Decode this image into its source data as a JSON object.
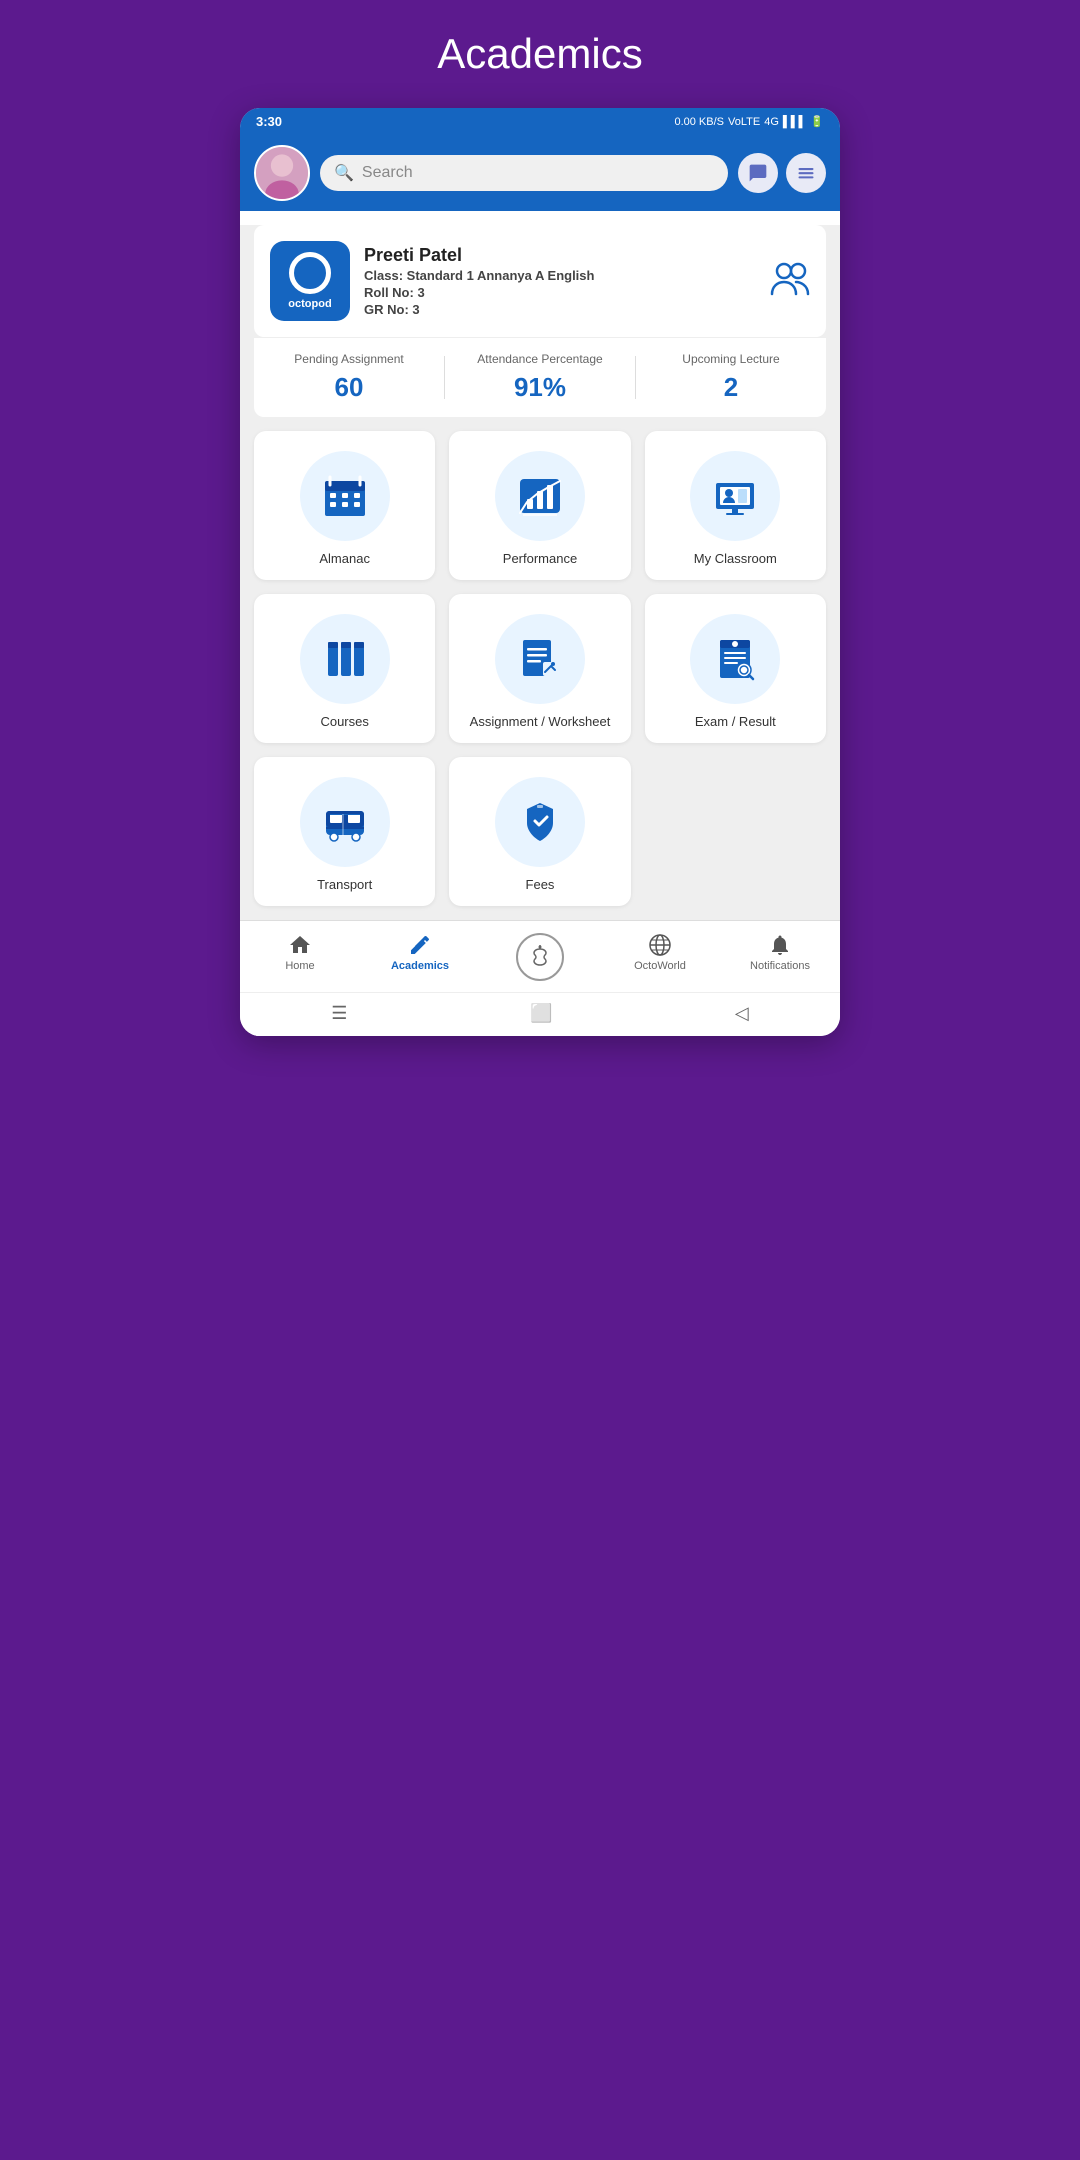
{
  "page": {
    "title": "Academics"
  },
  "statusBar": {
    "time": "3:30",
    "network": "0.00 KB/S",
    "carrier": "VoLTE",
    "signal": "4G",
    "battery": "6"
  },
  "header": {
    "searchPlaceholder": "Search",
    "searchIcon": "search-icon",
    "chatIcon": "chat-icon",
    "menuIcon": "menu-icon"
  },
  "profile": {
    "logoText": "octopod",
    "name": "Preeti Patel",
    "classLabel": "Class:",
    "classValue": "Standard 1 Annanya A English",
    "rollLabel": "Roll No:",
    "rollValue": "3",
    "grLabel": "GR No:",
    "grValue": "3"
  },
  "stats": [
    {
      "label": "Pending Assignment",
      "value": "60"
    },
    {
      "label": "Attendance Percentage",
      "value": "91%"
    },
    {
      "label": "Upcoming Lecture",
      "value": "2"
    }
  ],
  "grid": [
    {
      "id": "almanac",
      "label": "Almanac"
    },
    {
      "id": "performance",
      "label": "Performance"
    },
    {
      "id": "my-classroom",
      "label": "My Classroom"
    },
    {
      "id": "courses",
      "label": "Courses"
    },
    {
      "id": "assignment-worksheet",
      "label": "Assignment / Worksheet"
    },
    {
      "id": "exam-result",
      "label": "Exam / Result"
    },
    {
      "id": "transport",
      "label": "Transport"
    },
    {
      "id": "fees",
      "label": "Fees"
    }
  ],
  "bottomNav": [
    {
      "id": "home",
      "label": "Home",
      "active": false
    },
    {
      "id": "academics",
      "label": "Academics",
      "active": true
    },
    {
      "id": "octoworld-center",
      "label": "",
      "active": false,
      "isCenter": true
    },
    {
      "id": "octoworld",
      "label": "OctoWorld",
      "active": false
    },
    {
      "id": "notifications",
      "label": "Notifications",
      "active": false
    }
  ]
}
